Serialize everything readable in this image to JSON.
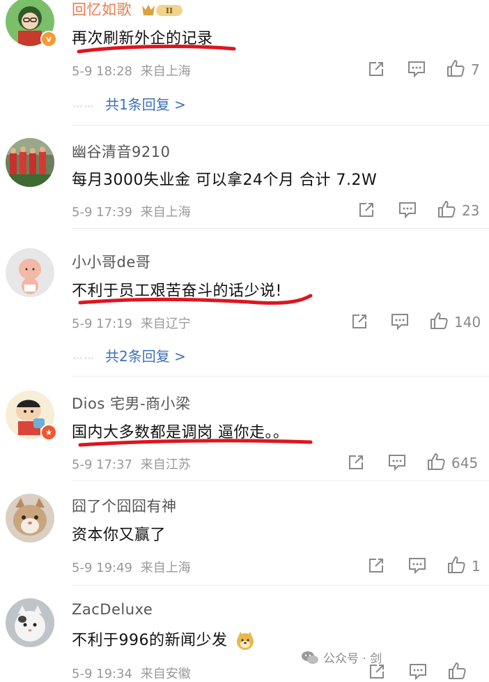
{
  "colors": {
    "reply_link": "#3b6fbb",
    "underline": "#e0141e",
    "vip_gold": "#d9a440",
    "username_orange": "#ec7a4a"
  },
  "comments": [
    {
      "username": "回忆如歌",
      "text": "再次刷新外企的记录",
      "date": "5-9 18:28",
      "location": "来自上海",
      "likes": "7",
      "replies": "共1条回复 >",
      "vip_badge": "II"
    },
    {
      "username": "幽谷清音9210",
      "text": "每月3000失业金 可以拿24个月 合计 7.2W",
      "date": "5-9 17:39",
      "location": "来自上海",
      "likes": "23"
    },
    {
      "username": "小小哥de哥",
      "text": "不利于员工艰苦奋斗的话少说!",
      "date": "5-9 17:19",
      "location": "来自辽宁",
      "likes": "140",
      "replies": "共2条回复 >"
    },
    {
      "username": "Dios 宅男-商小梁",
      "text": "国内大多数都是调岗  逼你走。。",
      "date": "5-9 17:37",
      "location": "来自江苏",
      "likes": "645"
    },
    {
      "username": "囧了个囧囧有神",
      "text": "资本你又赢了",
      "date": "5-9 19:49",
      "location": "来自上海",
      "likes": "1"
    },
    {
      "username": "ZacDeluxe",
      "text": "不利于996的新闻少发",
      "date": "5-9 19:34",
      "location": "来自安徽",
      "likes": ""
    }
  ],
  "dots": "⋯⋯",
  "watermark": "公众号 · 剑",
  "icons": {
    "share": "share-icon",
    "comment": "comment-icon",
    "like": "thumbs-up-icon",
    "badge_v": "verified-v-icon",
    "badge_star": "star-badge-icon",
    "wechat": "wechat-icon",
    "doge": "doge-emoji-icon"
  }
}
